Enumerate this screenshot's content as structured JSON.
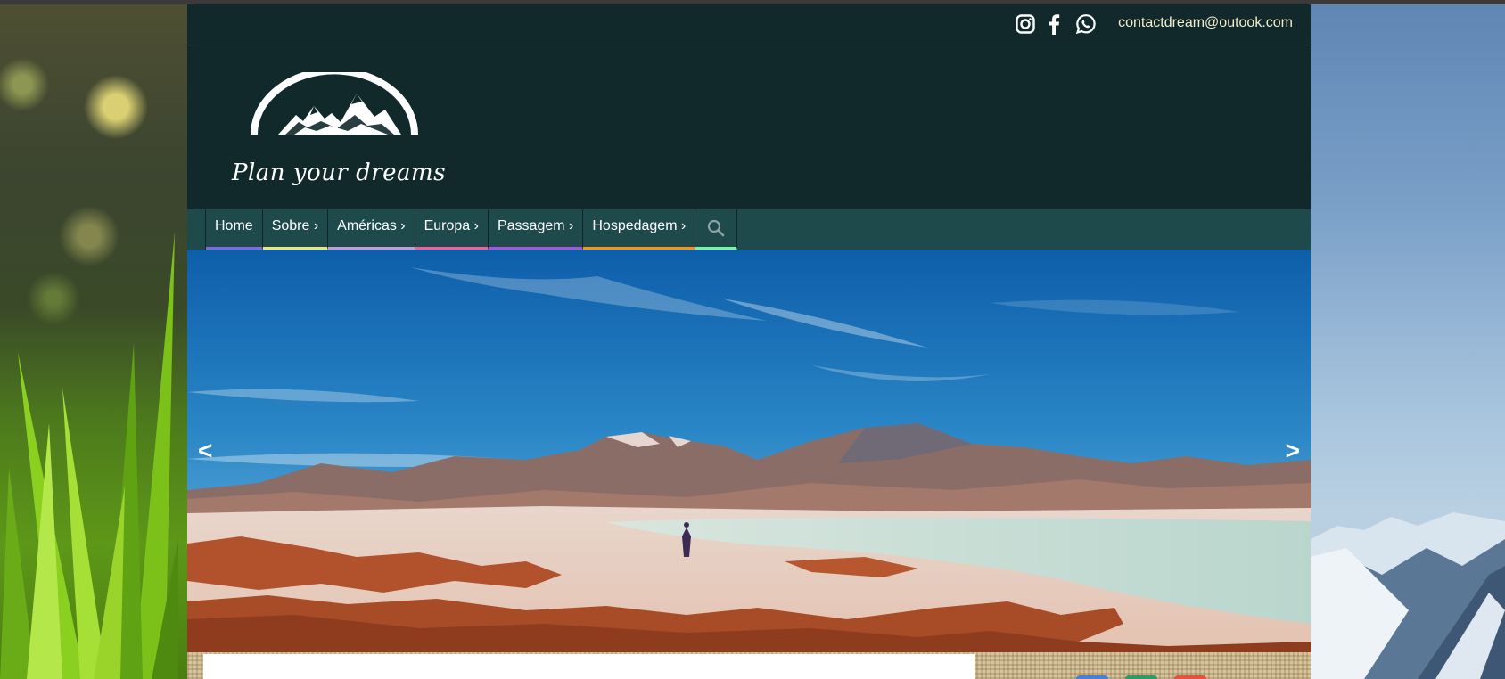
{
  "topbar": {
    "email": "contactdream@outook.com",
    "social": [
      {
        "icon": "instagram-icon"
      },
      {
        "icon": "facebook-icon"
      },
      {
        "icon": "whatsapp-icon"
      }
    ]
  },
  "header": {
    "logo_text": "Plan your dreams"
  },
  "nav": {
    "items": [
      {
        "label": "Home",
        "color": "#7b6ae0"
      },
      {
        "label": "Sobre ›",
        "color": "#e9e77a"
      },
      {
        "label": "Américas ›",
        "color": "#c79ad8"
      },
      {
        "label": "Europa ›",
        "color": "#f060a0"
      },
      {
        "label": "Passagem ›",
        "color": "#a457d8"
      },
      {
        "label": "Hospedagem ›",
        "color": "#f59314"
      }
    ],
    "search": {
      "icon": "search-icon",
      "color": "#7ff0a8"
    }
  },
  "slider": {
    "prev_label": "<",
    "next_label": ">"
  },
  "share_colors": [
    "#4a7fd6",
    "#2b9c68",
    "#e2543e"
  ]
}
